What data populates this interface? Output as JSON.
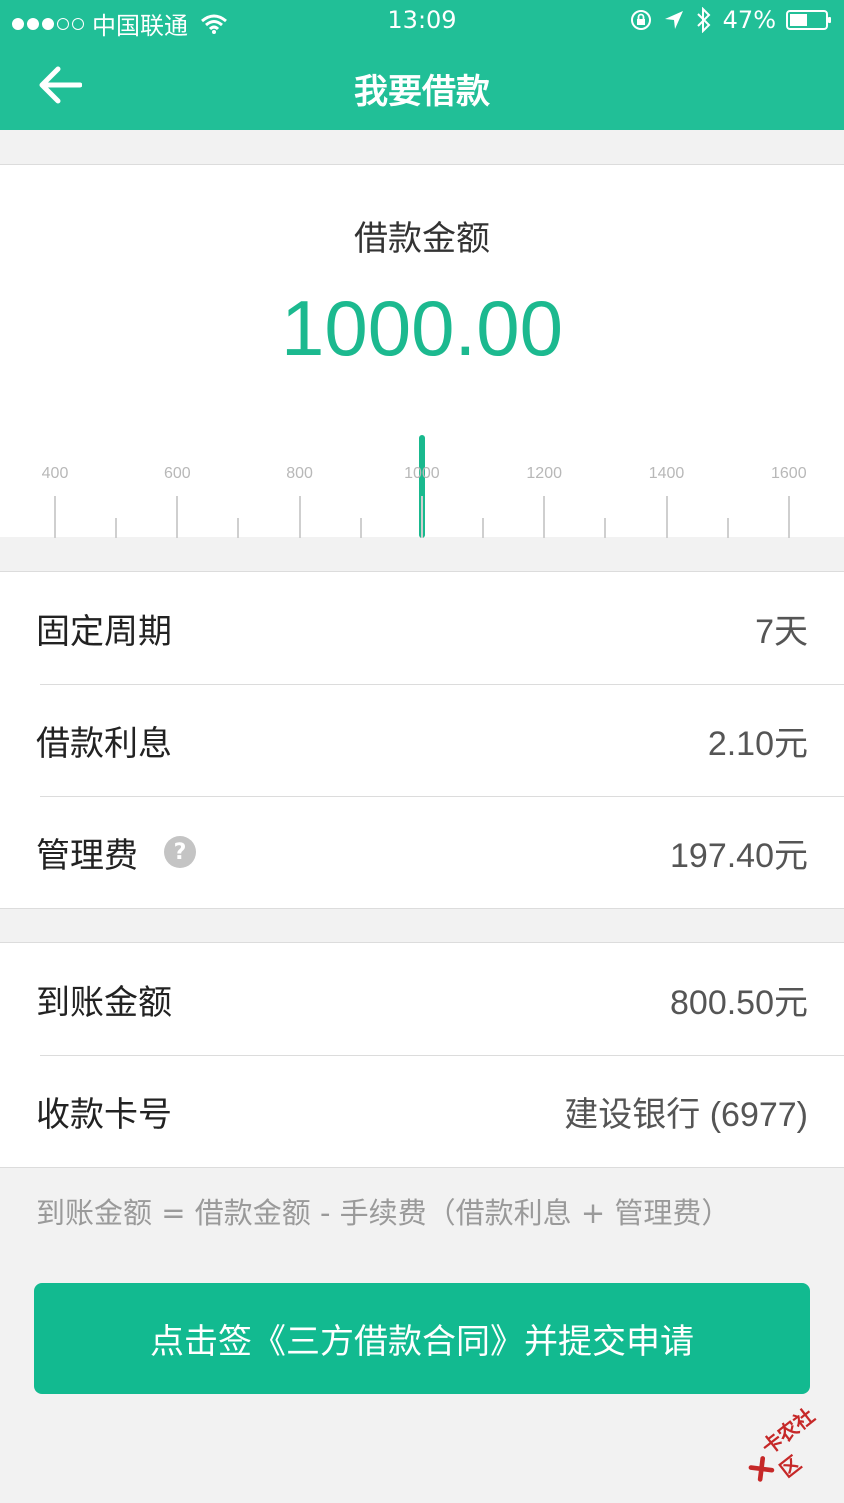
{
  "status_bar": {
    "carrier": "中国联通",
    "time": "13:09",
    "battery": "47%"
  },
  "nav": {
    "title": "我要借款"
  },
  "loan": {
    "amount_label": "借款金额",
    "amount_value": "1000.00",
    "ruler_labels": [
      "400",
      "600",
      "800",
      "1000",
      "1200",
      "1400",
      "1600"
    ]
  },
  "details": [
    {
      "label": "固定周期",
      "value": "7天"
    },
    {
      "label": "借款利息",
      "value": "2.10元"
    },
    {
      "label": "管理费",
      "value": "197.40元"
    }
  ],
  "receipt": [
    {
      "label": "到账金额",
      "value": "800.50元"
    },
    {
      "label": "收款卡号",
      "value": "建设银行 (6977)"
    }
  ],
  "formula": "到账金额 = 借款金额 - 手续费（借款利息 + 管理费）",
  "submit": {
    "label": "点击签《三方借款合同》并提交申请"
  },
  "watermark": "卡农社区",
  "colors": {
    "brand": "#21bf97",
    "amount": "#1cb98f",
    "button": "#12ba90"
  }
}
